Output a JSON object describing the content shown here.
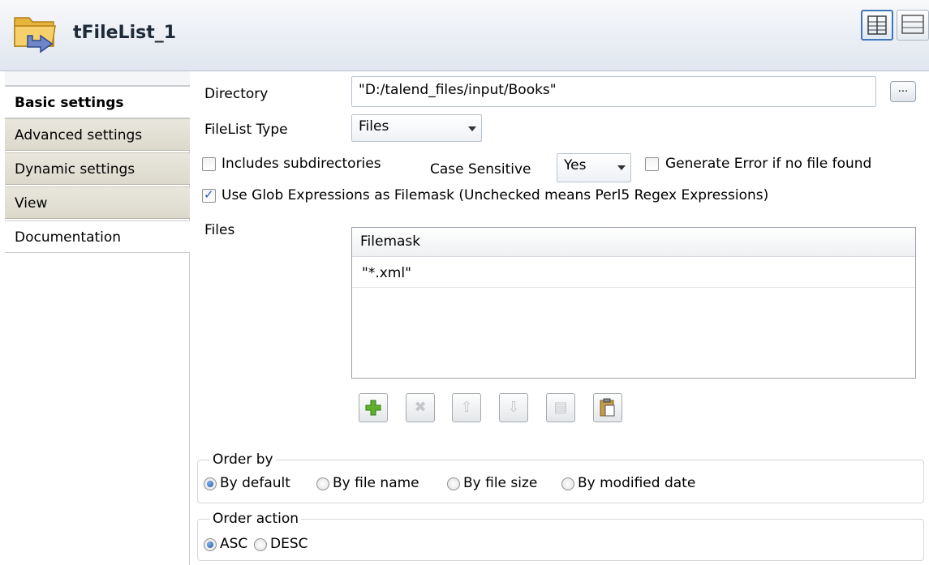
{
  "header": {
    "title": "tFileList_1"
  },
  "nav": {
    "items": [
      {
        "label": "Basic settings"
      },
      {
        "label": "Advanced settings"
      },
      {
        "label": "Dynamic settings"
      },
      {
        "label": "View"
      },
      {
        "label": "Documentation"
      }
    ]
  },
  "form": {
    "directory": {
      "label": "Directory",
      "value": "\"D:/talend_files/input/Books\"",
      "browse_label": "..."
    },
    "filelist_type": {
      "label": "FileList Type",
      "value": "Files"
    },
    "includes_subdirectories": {
      "label": "Includes subdirectories",
      "checked": false
    },
    "case_sensitive": {
      "label": "Case Sensitive",
      "value": "Yes"
    },
    "generate_error": {
      "label": "Generate Error if no file found",
      "checked": false
    },
    "use_glob": {
      "label": "Use Glob Expressions as Filemask (Unchecked means Perl5 Regex Expressions)",
      "checked": true
    },
    "files": {
      "label": "Files",
      "column": "Filemask",
      "rows": [
        "\"*.xml\""
      ]
    },
    "order_by": {
      "title": "Order by",
      "options": [
        "By default",
        "By file name",
        "By file size",
        "By modified date"
      ],
      "selected": "By default"
    },
    "order_action": {
      "title": "Order action",
      "options": [
        "ASC",
        "DESC"
      ],
      "selected": "ASC"
    }
  }
}
